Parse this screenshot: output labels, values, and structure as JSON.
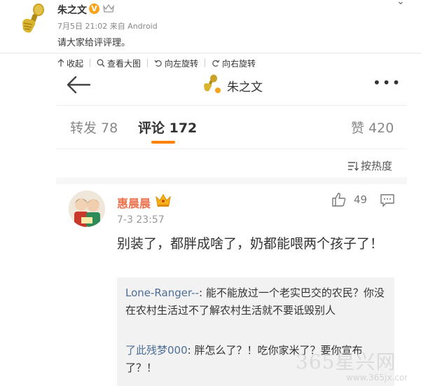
{
  "post": {
    "author": "朱之文",
    "vip_badge": "V",
    "meta": "7月5日 21:02 来自 Android",
    "text": "请大家给评评理。"
  },
  "toolbar": {
    "collapse": "收起",
    "view_large": "查看大图",
    "rotate_left": "向左旋转",
    "rotate_right": "向右旋转"
  },
  "screenshot": {
    "nav": {
      "title": "朱之文",
      "more": "•••"
    },
    "tabs": [
      {
        "label": "转发 78"
      },
      {
        "label": "评论 172"
      },
      {
        "label": "赞 420"
      }
    ],
    "sort_label": "按热度",
    "comment": {
      "author": "惠晨晨",
      "time": "7-3 23:57",
      "likes": "49",
      "text": "别装了，都胖成啥了，奶都能喂两个孩子了！",
      "replies": [
        {
          "user": "Lone-Ranger--",
          "text": ": 能不能放过一个老实巴交的农民？你没在农村生活过不了解农村生活就不要诋毁别人"
        },
        {
          "user": "了此残梦000",
          "text": ": 胖怎么了？！吃你家米了？要你宣布了？！"
        }
      ]
    },
    "watermark": "365星兴网",
    "watermark_url": "www.365jx.com"
  },
  "colors": {
    "accent_orange": "#ff8200",
    "name_orange": "#eb7350",
    "reply_user_blue": "#4d6e96",
    "vip_gold": "#f7a31b"
  }
}
